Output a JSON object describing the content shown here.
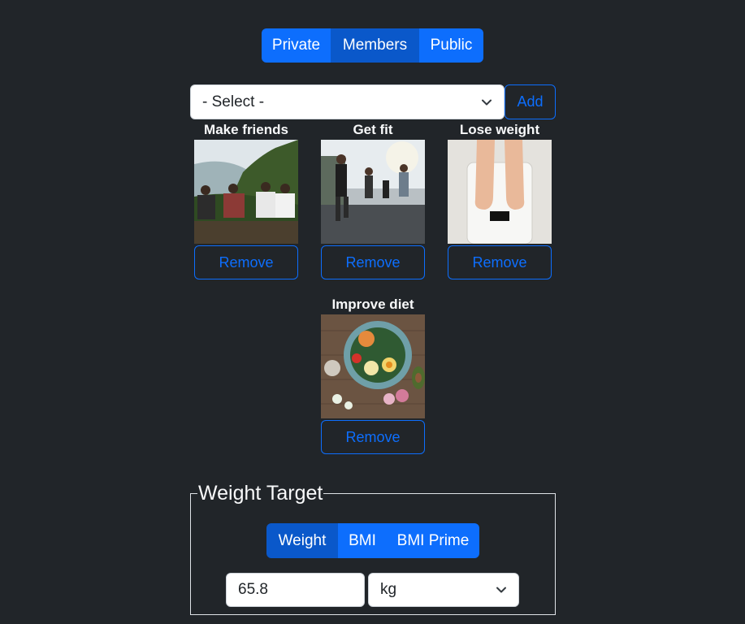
{
  "privacy": {
    "options": [
      "Private",
      "Members",
      "Public"
    ],
    "selected": "Members"
  },
  "goal_picker": {
    "selected": "- Select -",
    "add_label": "Add"
  },
  "goals": [
    {
      "title": "Make friends",
      "remove_label": "Remove"
    },
    {
      "title": "Get fit",
      "remove_label": "Remove"
    },
    {
      "title": "Lose weight",
      "remove_label": "Remove"
    },
    {
      "title": "Improve diet",
      "remove_label": "Remove"
    }
  ],
  "weight_target": {
    "legend": "Weight Target",
    "modes": [
      "Weight",
      "BMI",
      "BMI Prime"
    ],
    "selected_mode": "Weight",
    "value": "65.8",
    "unit": "kg"
  },
  "colors": {
    "background": "#212529",
    "primary": "#0d6efd",
    "primary_active": "#0a58ca"
  },
  "icons": {
    "select_arrow": "chevron-down-icon"
  }
}
